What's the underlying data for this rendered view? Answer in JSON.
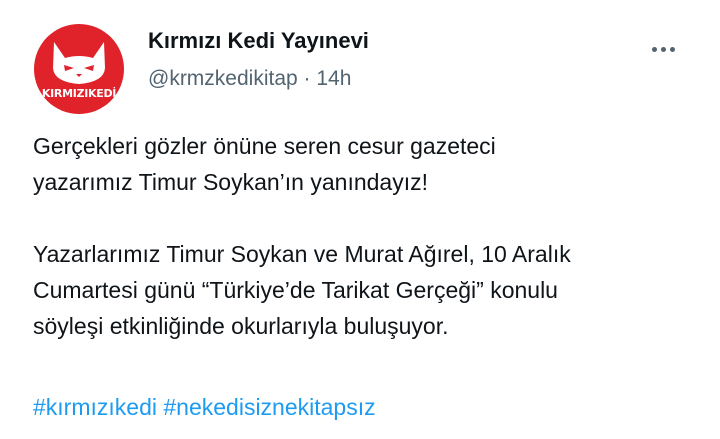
{
  "author": {
    "display_name": "Kırmızı Kedi Yayınevi",
    "handle": "@krmzkedikitap",
    "separator": "·",
    "time": "14h",
    "avatar_text": "KIRMIZIKEDİ"
  },
  "menu": {
    "icon": "more-horizontal-icon"
  },
  "tweet": {
    "line1": "Gerçekleri gözler önüne seren cesur gazeteci",
    "line2": "yazarımız Timur Soykan’ın yanındayız!",
    "line3": "Yazarlarımız Timur Soykan ve Murat Ağırel, 10 Aralık",
    "line4": "Cumartesi günü “Türkiye’de Tarikat Gerçeği” konulu",
    "line5": "söyleşi etkinliğinde okurlarıyla buluşuyor."
  },
  "hashtags": [
    "#kırmızıkedi",
    "#nekedisiznekitapsız"
  ],
  "colors": {
    "text": "#0f1419",
    "secondary": "#536471",
    "link": "#1d9bf0",
    "brand": "#e0222b"
  }
}
